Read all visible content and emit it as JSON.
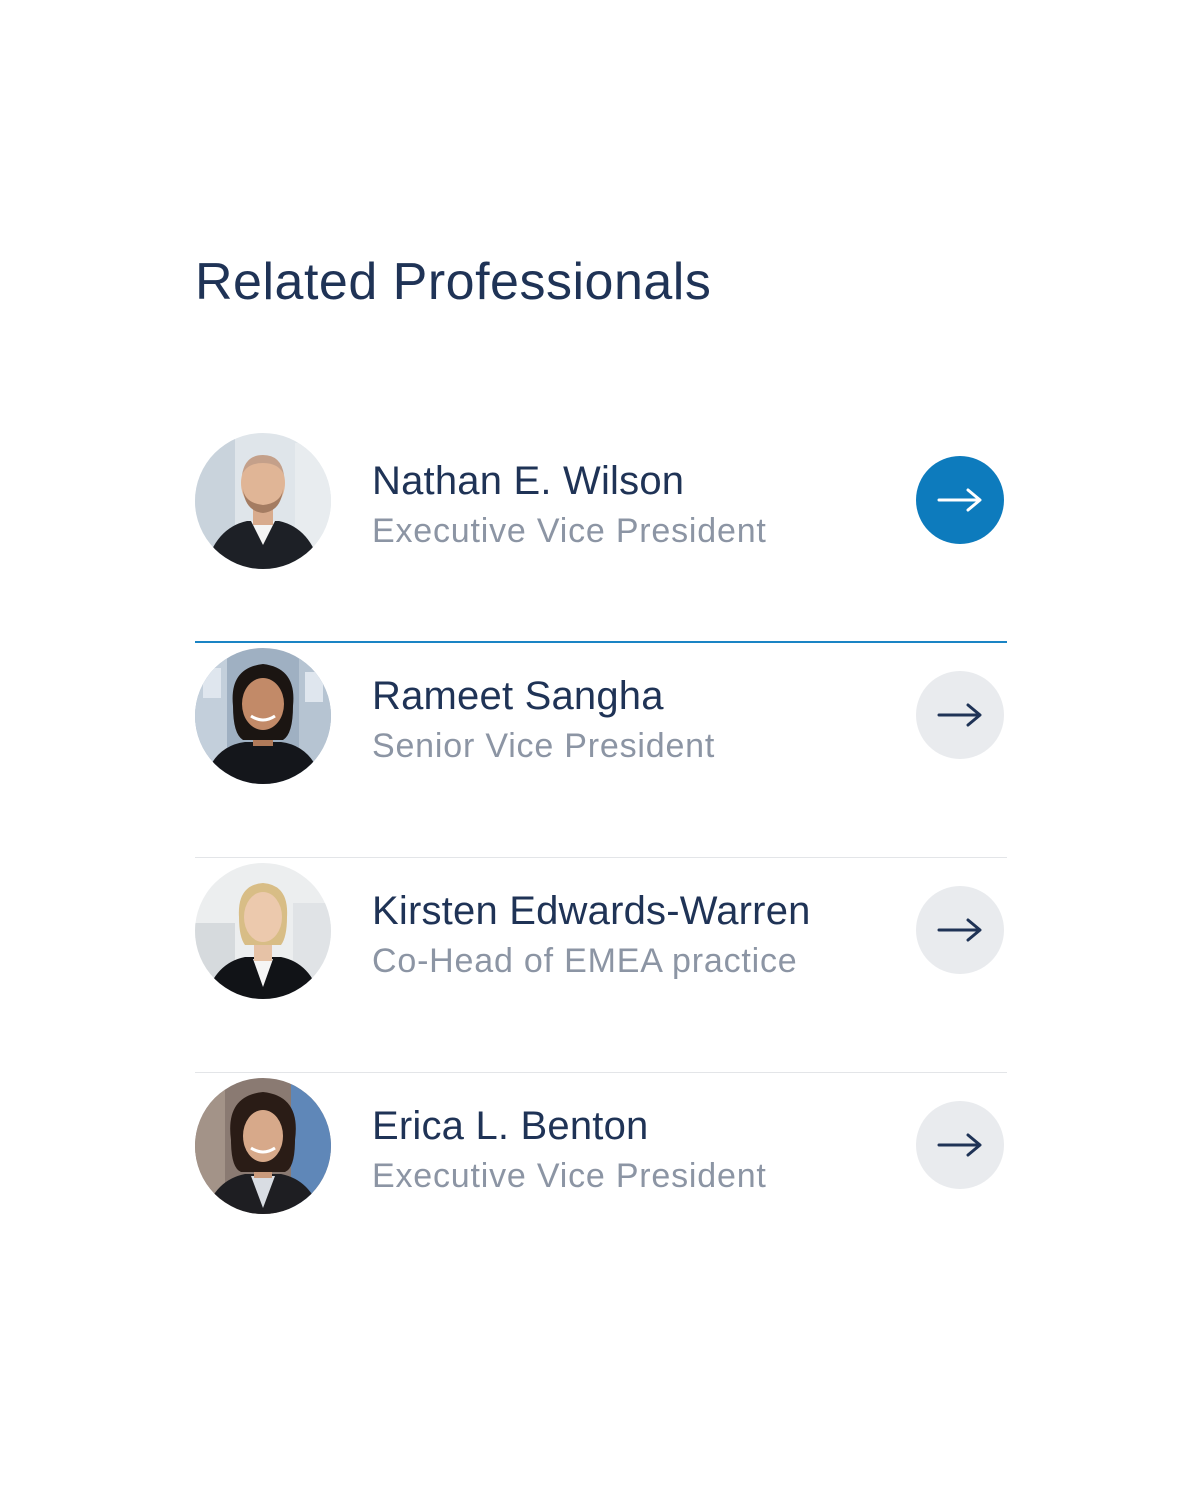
{
  "section": {
    "title": "Related Professionals"
  },
  "professionals": [
    {
      "name": "Nathan E. Wilson",
      "title": "Executive Vice President",
      "action_icon": "arrow-right-icon"
    },
    {
      "name": "Rameet Sangha",
      "title": "Senior Vice President",
      "action_icon": "arrow-right-icon"
    },
    {
      "name": "Kirsten Edwards-Warren",
      "title": "Co-Head of EMEA practice",
      "action_icon": "arrow-right-icon"
    },
    {
      "name": "Erica L. Benton",
      "title": "Executive Vice President",
      "action_icon": "arrow-right-icon"
    }
  ],
  "colors": {
    "heading": "#1f3356",
    "subtitle": "#8c95a4",
    "accent": "#0d7bbd",
    "active_divider": "#1a84c4",
    "divider": "#e3e5e8",
    "button_inactive": "#e9ebee"
  }
}
